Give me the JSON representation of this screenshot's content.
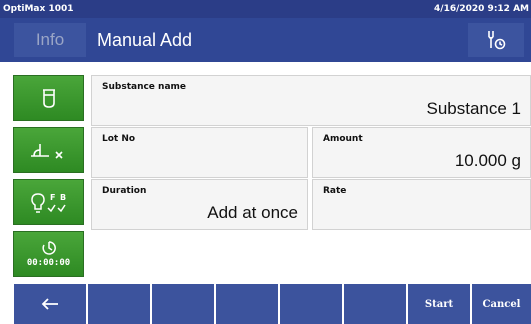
{
  "status_bar": {
    "device_name": "OptiMax 1001",
    "datetime": "4/16/2020 9:12 AM"
  },
  "title_bar": {
    "info_label": "Info",
    "title": "Manual Add",
    "tool_icon": "tool-settings-icon"
  },
  "side_keys": [
    {
      "icon": "beaker-icon"
    },
    {
      "icon": "tare-clear-icon"
    },
    {
      "icon": "bulb-fb-icon"
    },
    {
      "icon": "timer-icon",
      "timer": "00:00:00"
    }
  ],
  "fields": {
    "substance_name": {
      "label": "Substance name",
      "value": "Substance 1"
    },
    "lot_no": {
      "label": "Lot No",
      "value": ""
    },
    "amount": {
      "label": "Amount",
      "value": "10.000 g"
    },
    "duration": {
      "label": "Duration",
      "value": "Add at once"
    },
    "rate": {
      "label": "Rate",
      "value": ""
    }
  },
  "bottom_bar": {
    "back_icon": "arrow-left-icon",
    "start_label": "Start",
    "cancel_label": "Cancel"
  },
  "colors": {
    "header_dark": "#2b3d87",
    "header": "#304795",
    "button_blue": "#3c539d",
    "key_green": "#3a9a2e",
    "field_bg": "#f5f5f5"
  }
}
